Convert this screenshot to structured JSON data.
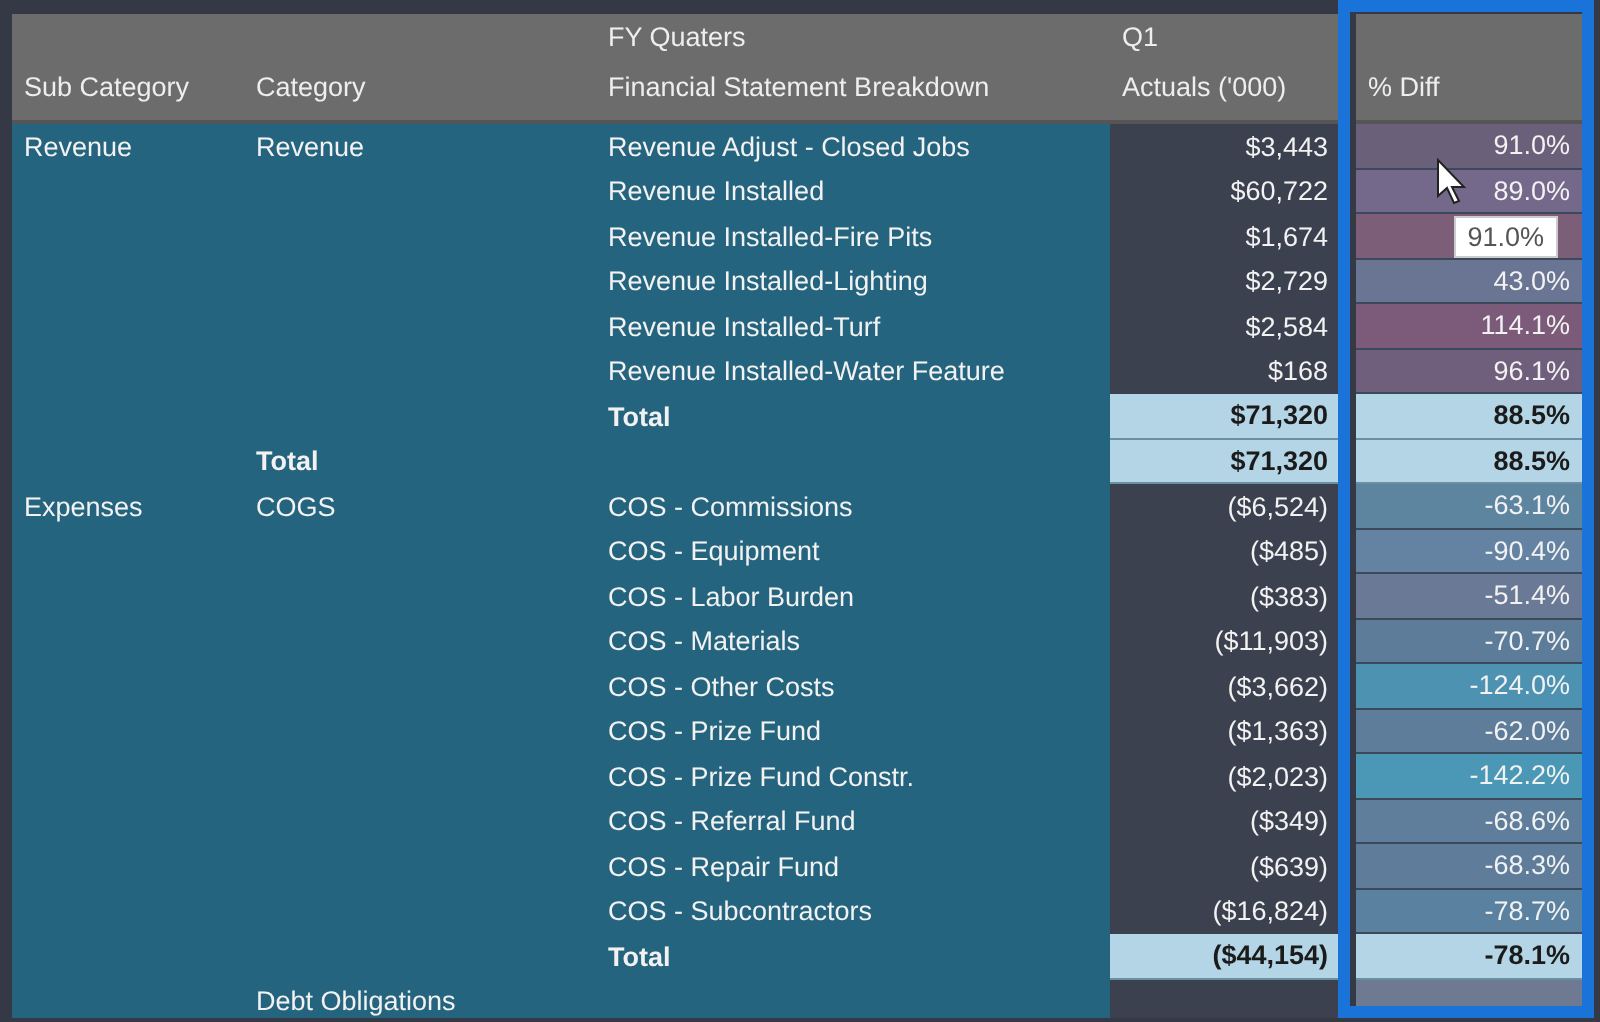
{
  "header": {
    "columns": [
      {
        "label": "Sub Category"
      },
      {
        "label": "Category"
      },
      {
        "label": "Financial Statement Breakdown",
        "group": "FY Quaters"
      },
      {
        "label": "Actuals ('000)",
        "group": "Q1"
      },
      {
        "label": "% Diff"
      }
    ]
  },
  "rows": [
    {
      "kind": "line",
      "subcategory": "Revenue",
      "category": "Revenue",
      "breakdown": "Revenue Adjust - Closed Jobs",
      "actual": "$3,443",
      "pct": "91.0%",
      "color": "#6b6079"
    },
    {
      "kind": "line",
      "breakdown": "Revenue Installed",
      "actual": "$60,722",
      "pct": "89.0%",
      "color": "#74698a",
      "cursor": true
    },
    {
      "kind": "line",
      "breakdown": "Revenue Installed-Fire Pits",
      "actual": "$1,674",
      "tooltip": "91.0%",
      "color": "#7d5e78"
    },
    {
      "kind": "line",
      "breakdown": "Revenue Installed-Lighting",
      "actual": "$2,729",
      "pct": "43.0%",
      "color": "#6a7493"
    },
    {
      "kind": "line",
      "breakdown": "Revenue Installed-Turf",
      "actual": "$2,584",
      "pct": "114.1%",
      "color": "#7c5a79"
    },
    {
      "kind": "line",
      "breakdown": "Revenue Installed-Water Feature",
      "actual": "$168",
      "pct": "96.1%",
      "color": "#705e7d"
    },
    {
      "kind": "total",
      "breakdown": "Total",
      "actual": "$71,320",
      "pct": "88.5%"
    },
    {
      "kind": "category_total",
      "category": "Total",
      "actual": "$71,320",
      "pct": "88.5%"
    },
    {
      "kind": "line",
      "subcategory": "Expenses",
      "category": "COGS",
      "breakdown": "COS - Commissions",
      "actual": "($6,524)",
      "pct": "-63.1%",
      "color": "#5e85a0"
    },
    {
      "kind": "line",
      "breakdown": "COS - Equipment",
      "actual": "($485)",
      "pct": "-90.4%",
      "color": "#6483a2"
    },
    {
      "kind": "line",
      "breakdown": "COS - Labor Burden",
      "actual": "($383)",
      "pct": "-51.4%",
      "color": "#6a7a96"
    },
    {
      "kind": "line",
      "breakdown": "COS - Materials",
      "actual": "($11,903)",
      "pct": "-70.7%",
      "color": "#5c7c9a"
    },
    {
      "kind": "line",
      "breakdown": "COS - Other Costs",
      "actual": "($3,662)",
      "pct": "-124.0%",
      "color": "#4d92b0"
    },
    {
      "kind": "line",
      "breakdown": "COS - Prize Fund",
      "actual": "($1,363)",
      "pct": "-62.0%",
      "color": "#5e7d9a"
    },
    {
      "kind": "line",
      "breakdown": "COS - Prize Fund Constr.",
      "actual": "($2,023)",
      "pct": "-142.2%",
      "color": "#4a98b6"
    },
    {
      "kind": "line",
      "breakdown": "COS - Referral Fund",
      "actual": "($349)",
      "pct": "-68.6%",
      "color": "#5e7e9c"
    },
    {
      "kind": "line",
      "breakdown": "COS - Repair Fund",
      "actual": "($639)",
      "pct": "-68.3%",
      "color": "#5f7d9b"
    },
    {
      "kind": "line",
      "breakdown": "COS - Subcontractors",
      "actual": "($16,824)",
      "pct": "-78.7%",
      "color": "#5a82a0"
    },
    {
      "kind": "total",
      "breakdown": "Total",
      "actual": "($44,154)",
      "pct": "-78.1%"
    },
    {
      "kind": "line",
      "category": "Debt Obligations",
      "color": "#6e7a92"
    }
  ]
}
